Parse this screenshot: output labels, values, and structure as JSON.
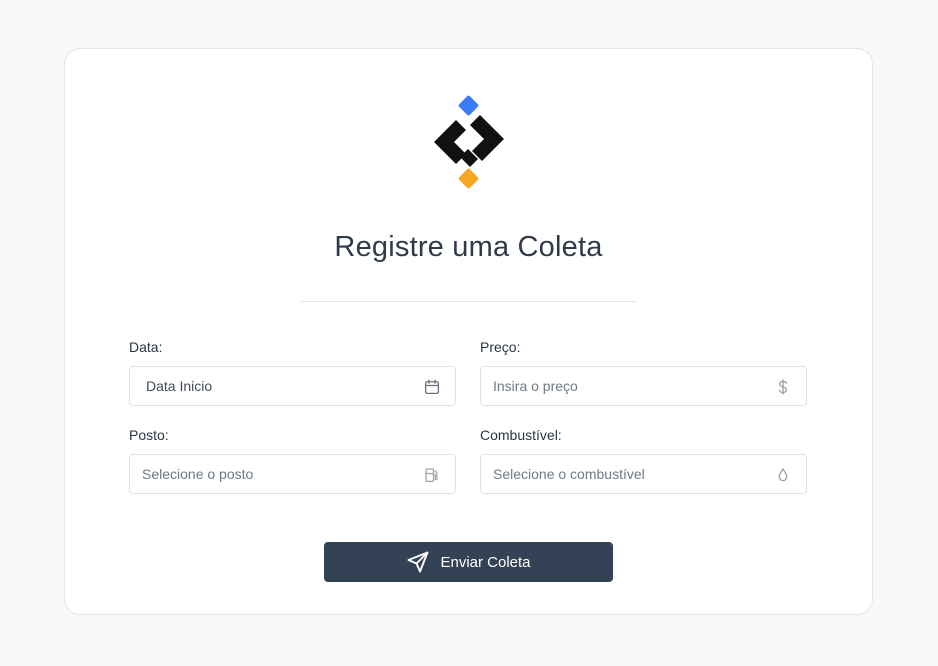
{
  "page": {
    "title": "Registre uma Coleta"
  },
  "colors": {
    "background": "#f7f8fa",
    "card": "#ffffff",
    "button": "#344256",
    "logo_primary": "#111111",
    "logo_top": "#3b7bf6",
    "logo_bottom": "#f5a623"
  },
  "form": {
    "data": {
      "label": "Data:",
      "value": "Data Inicio",
      "icon": "calendar-icon"
    },
    "preco": {
      "label": "Preço:",
      "placeholder": "Insira o preço",
      "icon": "dollar-icon"
    },
    "posto": {
      "label": "Posto:",
      "placeholder": "Selecione o posto",
      "icon": "fuel-pump-icon"
    },
    "combustivel": {
      "label": "Combustível:",
      "placeholder": "Selecione o combustível",
      "icon": "droplet-icon"
    },
    "submit": {
      "label": "Enviar Coleta",
      "icon": "send-icon"
    }
  }
}
